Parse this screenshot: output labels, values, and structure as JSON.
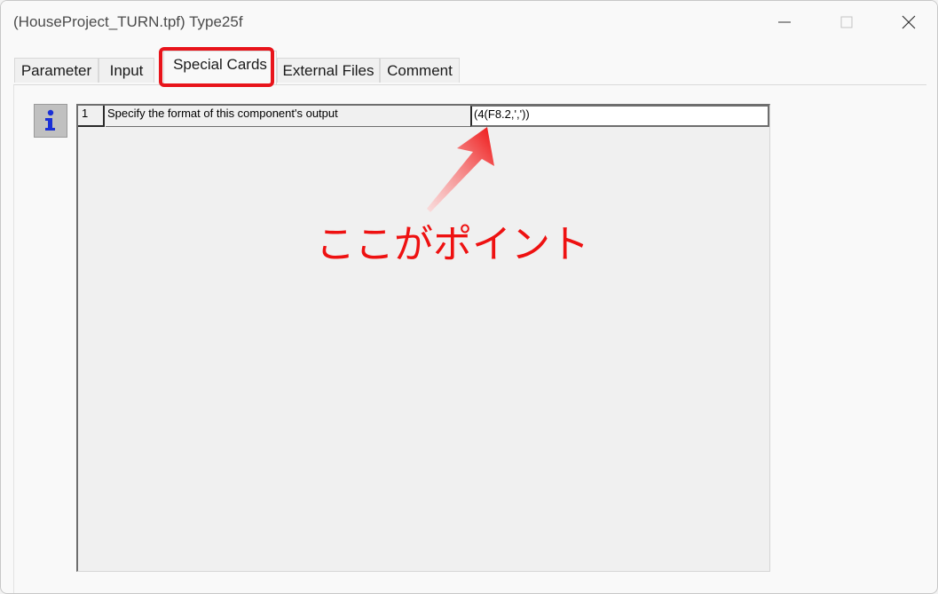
{
  "window": {
    "title": "(HouseProject_TURN.tpf) Type25f"
  },
  "tabs": [
    {
      "label": "Parameter",
      "active": false
    },
    {
      "label": "Input",
      "active": false
    },
    {
      "label": "Special Cards",
      "active": true
    },
    {
      "label": "External Files",
      "active": false
    },
    {
      "label": "Comment",
      "active": false
    }
  ],
  "grid": {
    "rows": [
      {
        "number": "1",
        "description": "Specify the format of this component's output",
        "value": "(4(F8.2,','))"
      }
    ]
  },
  "info_button": {
    "icon": "info-icon"
  },
  "annotation": {
    "text": "ここがポイント",
    "color": "#ee1111"
  },
  "colors": {
    "highlight": "#e8141b",
    "info_icon": "#1a2fd6"
  }
}
